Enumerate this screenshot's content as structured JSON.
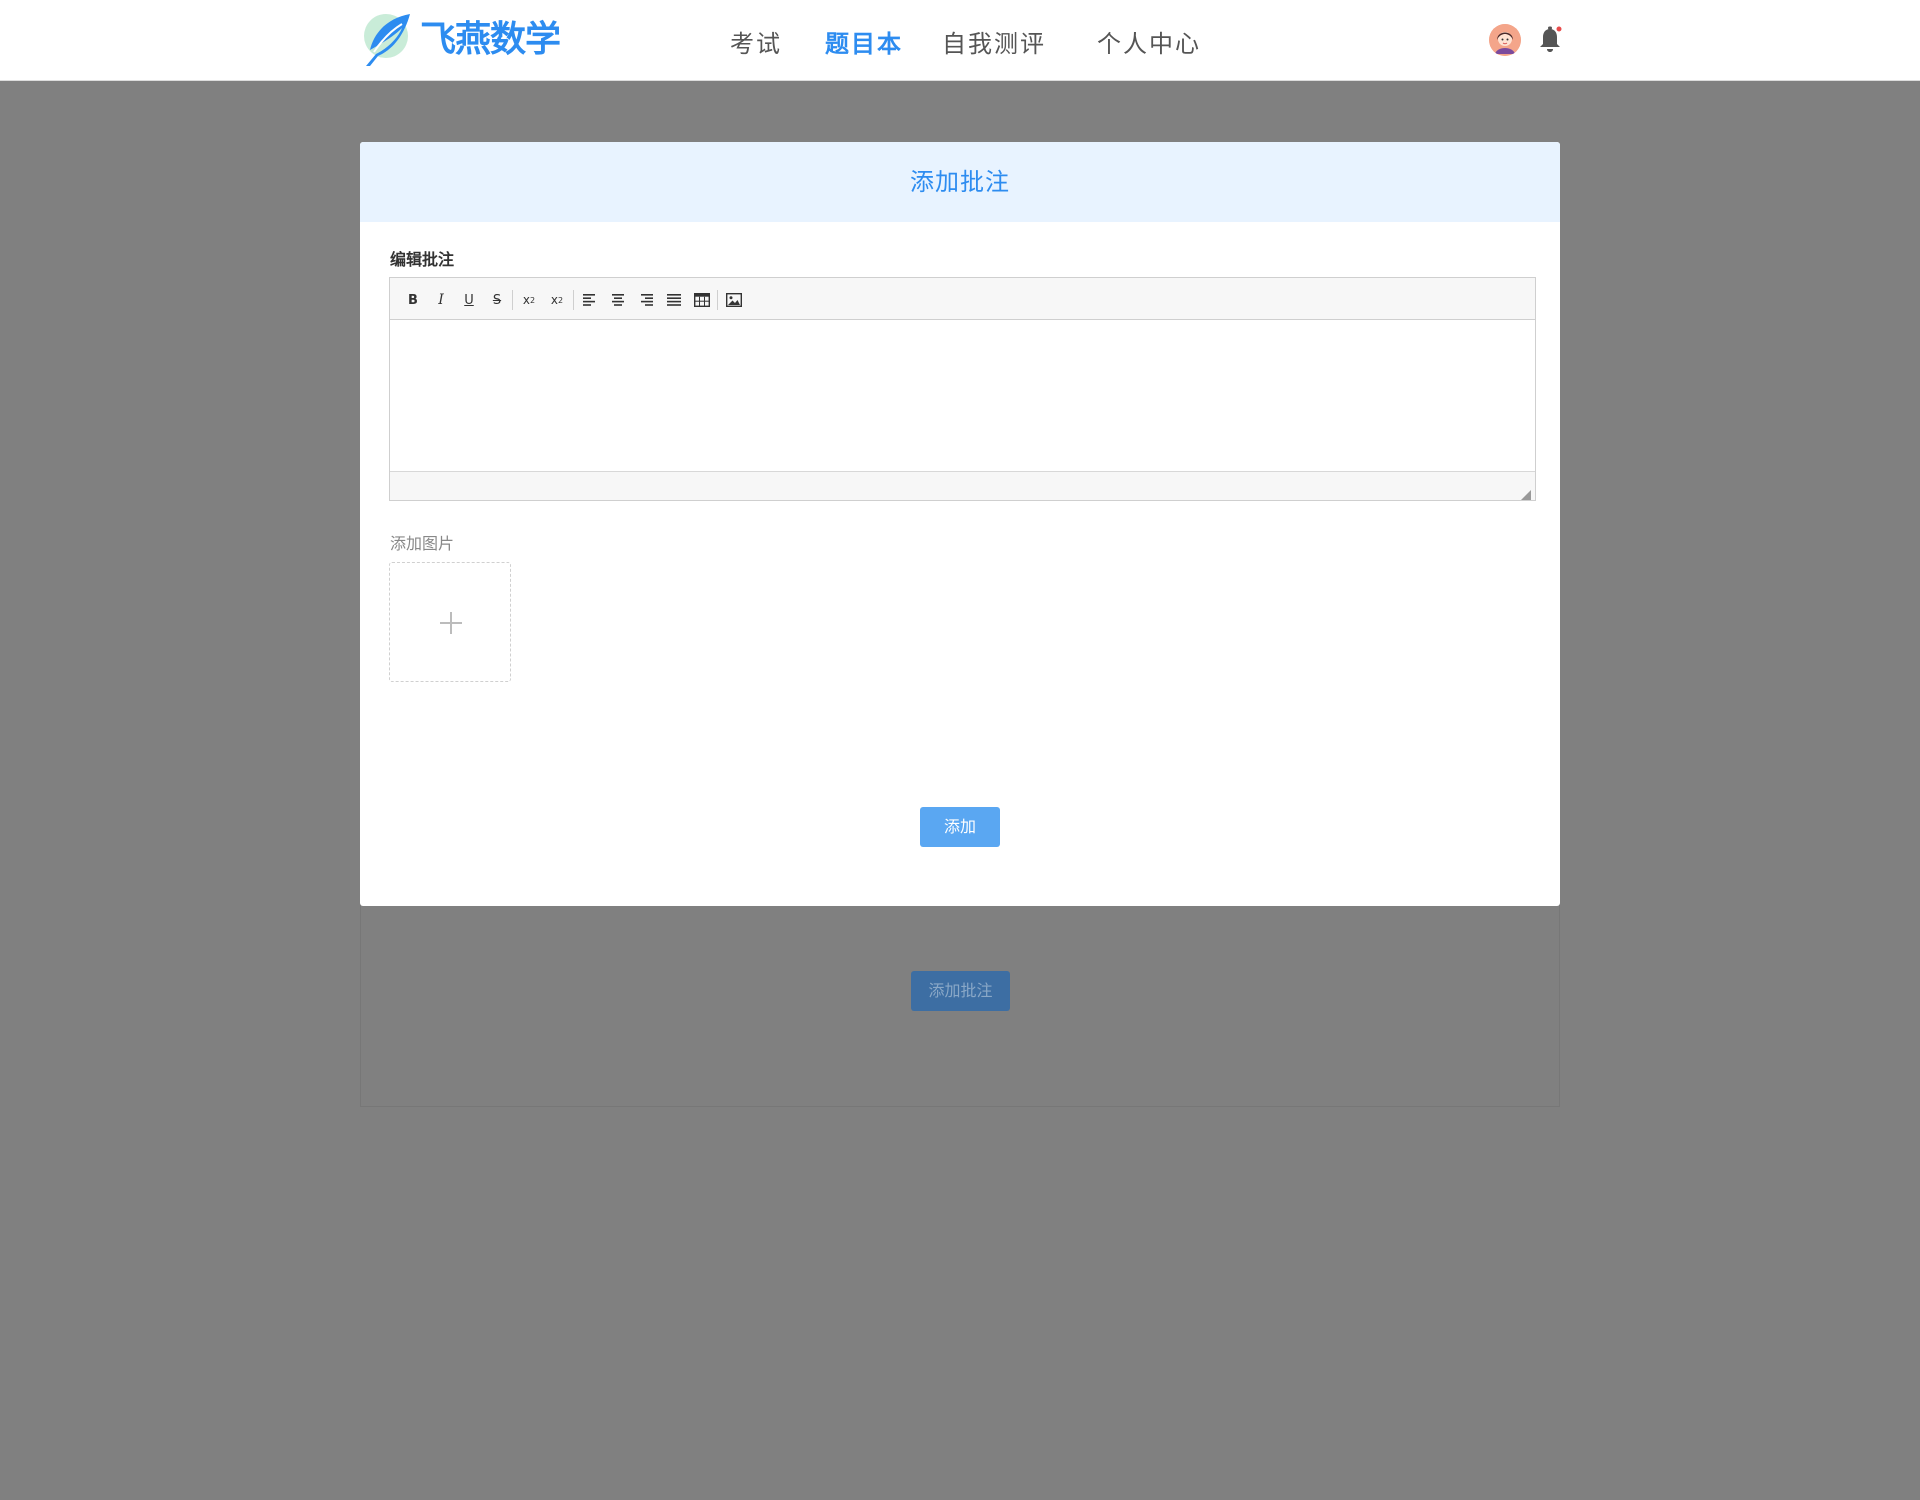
{
  "header": {
    "logo_text": "飞燕数学",
    "nav": [
      {
        "label": "考试"
      },
      {
        "label": "题目本"
      },
      {
        "label": "自我测评"
      },
      {
        "label": "个人中心"
      }
    ],
    "active_nav": "题目本"
  },
  "background_page": {
    "add_annotation_button": "添加批注"
  },
  "dialog": {
    "title": "添加批注",
    "editor_label": "编辑批注",
    "editor_content": "",
    "toolbar": [
      "bold-icon",
      "italic-icon",
      "underline-icon",
      "strikethrough-icon",
      "subscript-icon",
      "superscript-icon",
      "align-left-icon",
      "align-center-icon",
      "align-right-icon",
      "align-justify-icon",
      "table-icon",
      "image-icon"
    ],
    "upload_label": "添加图片",
    "submit_label": "添加"
  },
  "colors": {
    "accent": "#2d8cf0",
    "dialog_header_bg": "#e8f3ff",
    "submit_button": "#5aa7f2",
    "overlay": "#808080"
  }
}
